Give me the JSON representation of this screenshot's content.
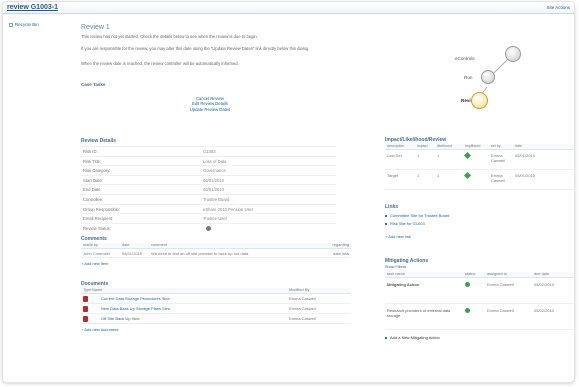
{
  "top": {
    "title": "review G1003-1",
    "site_actions": "Site Actions"
  },
  "sidebar": {
    "recycle_bin": "Recycle Bin"
  },
  "header": {
    "title": "Review 1",
    "p1": "This review has not yet started. Check the details below to see when the review is due to begin.",
    "p2": "If you are responsible for the review, you may alter this date using the \"Update Review Dates\" link directly below this dialog.",
    "p3": "When the review date is reached, the review controller will be automatically informed."
  },
  "case_tasks": {
    "title": "Case Tasks",
    "links": [
      "Cancel Review",
      "Edit Review Details",
      "Update Review Dates"
    ]
  },
  "flow": {
    "steps": [
      "eControls",
      "Run",
      "Review"
    ]
  },
  "review_details": {
    "title": "Review Details",
    "rows": [
      {
        "label": "Risk ID:",
        "value": "G1003"
      },
      {
        "label": "Risk Title:",
        "value": "Loss of Data"
      },
      {
        "label": "Risk Category:",
        "value": "Governance"
      },
      {
        "label": "Start Date:",
        "value": "06/01/2010"
      },
      {
        "label": "End Date:",
        "value": "06/01/2010"
      },
      {
        "label": "Controllee:",
        "value": "Trustee Board"
      },
      {
        "label": "Group Responsible:",
        "value": "eShare 2010 Pension User"
      },
      {
        "label": "Email Recipient:",
        "value": "Trustee User"
      },
      {
        "label": "Review Status:",
        "value": ""
      }
    ]
  },
  "comments": {
    "title": "Comments",
    "headers": [
      "made by",
      "date",
      "comment",
      "regarding"
    ],
    "rows": [
      {
        "made_by": "John Controller",
        "date": "08/31/2010",
        "comment": "We need to find an off site provider to back up our data.",
        "regarding": "data loss"
      }
    ],
    "add_link": "Add new item"
  },
  "documents": {
    "title": "Documents",
    "headers": [
      "Type",
      "Name",
      "Modified By"
    ],
    "rows": [
      {
        "name": "Current Data Storage Procedures",
        "badge": "!New",
        "modified_by": "Emma Caswell"
      },
      {
        "name": "New Data Back Up Storage Plans",
        "badge": "!New",
        "modified_by": "Emma Caswell"
      },
      {
        "name": "Off Site Back Up",
        "badge": "!New",
        "modified_by": "Emma Caswell"
      }
    ],
    "add_link": "Add new document"
  },
  "likelihood": {
    "title": "Impact/Likelihood/Review",
    "headers": [
      "description",
      "impact",
      "likelihood",
      "impliheed",
      "set by",
      "date"
    ],
    "rows": [
      {
        "description": "Last Set",
        "impact": "1",
        "likelihood": "1",
        "set_by": "Emma Caswell",
        "date": "05/01/2010"
      },
      {
        "description": "Target",
        "impact": "1",
        "likelihood": "1",
        "set_by": "Emma Caswell",
        "date": "05/01/2010"
      }
    ]
  },
  "links": {
    "title": "Links",
    "items": [
      "Committee Site for Trustee Board",
      "Risk Site for G1003"
    ],
    "add_link": "Add new link"
  },
  "mitigating": {
    "title": "Mitigating Actions",
    "show_filters": "Show Filters",
    "headers": [
      "task name",
      "status",
      "assigned to",
      "due date"
    ],
    "rows": [
      {
        "task": "Mitigating Action",
        "assigned": "Emma Caswell",
        "due": "05/02/2010"
      },
      {
        "task": "Research providers of external data storage",
        "assigned": "Emma Caswell",
        "due": "05/02/2010"
      }
    ],
    "add_link": "Add a New Mitigating Action"
  },
  "colors": {
    "link": "#1f5c99",
    "status_green": "#3aa24a",
    "pdf_red": "#b32d2d"
  }
}
